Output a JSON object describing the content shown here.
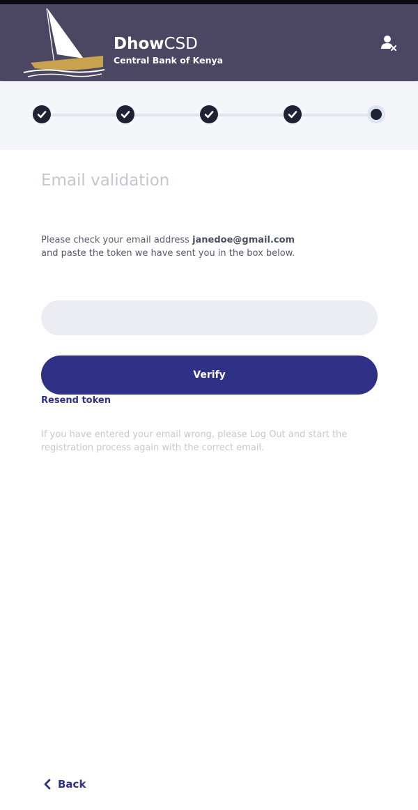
{
  "header": {
    "brand_bold": "Dhow",
    "brand_light": "CSD",
    "subtitle": "Central Bank of Kenya",
    "user_icon": "user-remove-icon"
  },
  "stepper": {
    "total_steps": 5,
    "completed_steps": 4,
    "current_step": 5
  },
  "main": {
    "title": "Email validation",
    "instruction_prefix": "Please check your email address ",
    "email": "janedoe@gmail.com",
    "instruction_suffix": "and paste the token we have sent you in the box below.",
    "token_value": "",
    "verify_label": "Verify",
    "resend_label": "Resend token",
    "note": "If you have entered your email wrong, please Log Out and start the registration process again with the correct email."
  },
  "footer": {
    "back_label": "Back"
  },
  "colors": {
    "header_bg": "#4b4763",
    "primary": "#2e3186",
    "step_done": "#1f2233",
    "input_bg": "#ebedf3"
  }
}
